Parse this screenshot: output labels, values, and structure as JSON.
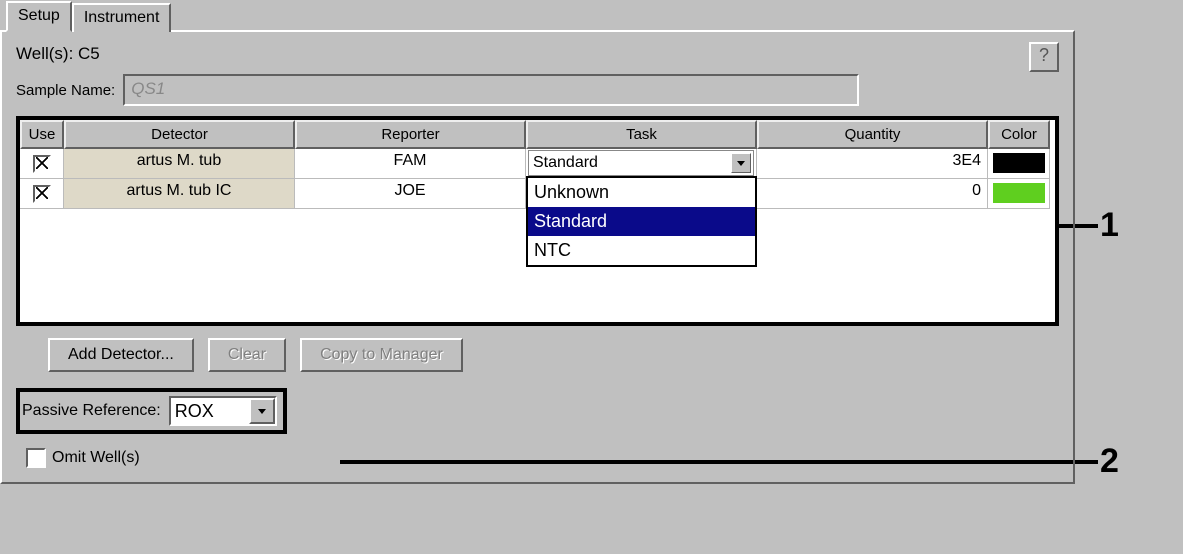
{
  "tabs": [
    {
      "label": "Setup",
      "active": true
    },
    {
      "label": "Instrument",
      "active": false
    }
  ],
  "wells_label": "Well(s): C5",
  "help_label": "?",
  "sample_name_label": "Sample Name:",
  "sample_name_value": "QS1",
  "table": {
    "headers": {
      "use": "Use",
      "detector": "Detector",
      "reporter": "Reporter",
      "task": "Task",
      "quantity": "Quantity",
      "color": "Color"
    },
    "rows": [
      {
        "use": true,
        "detector": "artus M. tub",
        "reporter": "FAM",
        "task": "Standard",
        "quantity": "3E4",
        "color": "#000000"
      },
      {
        "use": true,
        "detector": "artus M. tub IC",
        "reporter": "JOE",
        "task": "",
        "quantity": "0",
        "color": "#5fcf1f"
      }
    ]
  },
  "task_dropdown": {
    "options": [
      "Unknown",
      "Standard",
      "NTC"
    ],
    "selected": "Standard"
  },
  "buttons": {
    "add_detector": "Add Detector...",
    "clear": "Clear",
    "copy_mgr": "Copy to Manager"
  },
  "passive_ref": {
    "label": "Passive Reference:",
    "value": "ROX"
  },
  "omit_label": "Omit Well(s)",
  "callouts": {
    "one": "1",
    "two": "2"
  }
}
